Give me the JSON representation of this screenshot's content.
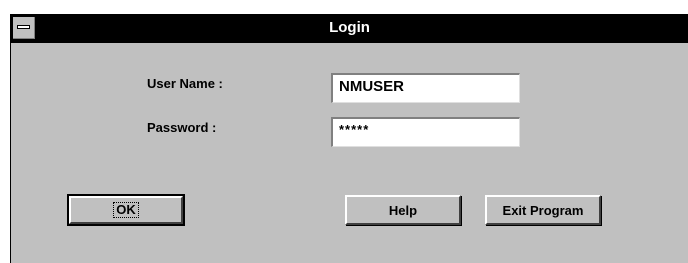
{
  "window": {
    "title": "Login",
    "system_menu_icon": "system-menu-icon"
  },
  "form": {
    "username_label": "User Name :",
    "username_value": "NMUSER",
    "password_label": "Password :",
    "password_value": "*****"
  },
  "buttons": {
    "ok": "OK",
    "help": "Help",
    "exit": "Exit Program"
  }
}
